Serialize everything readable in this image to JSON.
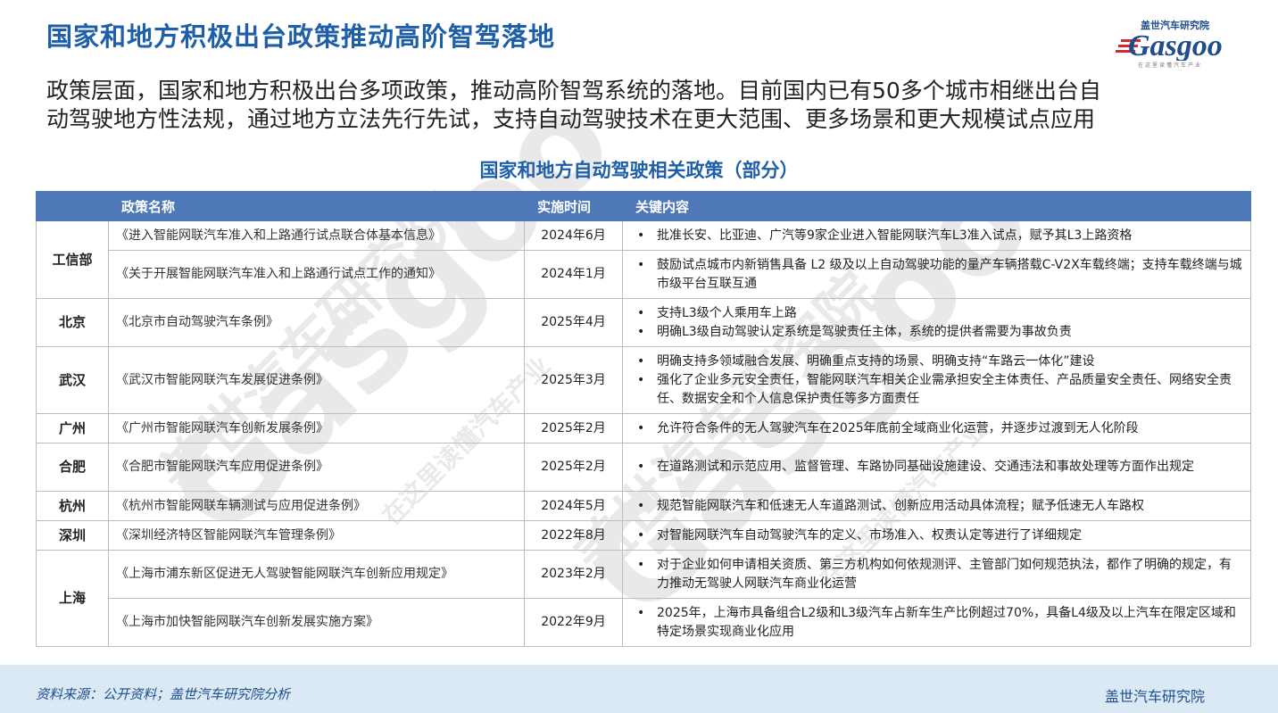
{
  "title": "国家和地方积极出台政策推动高阶智驾落地",
  "logo": {
    "top_text": "盖世汽车研究院",
    "word": "Gasgoo",
    "sub_text": "在这里读懂汽车产业"
  },
  "intro_lines": [
    "政策层面，国家和地方积极出台多项政策，推动高阶智驾系统的落地。目前国内已有50多个城市相继出台自",
    "动驾驶地方性法规，通过地方立法先行先试，支持自动驾驶技术在更大范围、更多场景和更大规模试点应用"
  ],
  "table_caption": "国家和地方自动驾驶相关政策（部分）",
  "table": {
    "headers": [
      "",
      "政策名称",
      "实施时间",
      "关键内容"
    ],
    "groups": [
      {
        "region": "工信部",
        "rows": [
          {
            "name": "《进入智能网联汽车准入和上路通行试点联合体基本信息》",
            "date": "2024年6月",
            "points": [
              "批准长安、比亚迪、广汽等9家企业进入智能网联汽车L3准入试点，赋予其L3上路资格"
            ]
          },
          {
            "name": "《关于开展智能网联汽车准入和上路通行试点工作的通知》",
            "date": "2024年1月",
            "points": [
              "鼓励试点城市内新销售具备 L2 级及以上自动驾驶功能的量产车辆搭载C-V2X车载终端；支持车载终端与城市级平台互联互通"
            ]
          }
        ]
      },
      {
        "region": "北京",
        "rows": [
          {
            "name": "《北京市自动驾驶汽车条例》",
            "date": "2025年4月",
            "points": [
              "支持L3级个人乘用车上路",
              "明确L3级自动驾驶认定系统是驾驶责任主体，系统的提供者需要为事故负责"
            ]
          }
        ]
      },
      {
        "region": "武汉",
        "rows": [
          {
            "name": "《武汉市智能网联汽车发展促进条例》",
            "date": "2025年3月",
            "points": [
              "明确支持多领域融合发展、明确重点支持的场景、明确支持“车路云一体化”建设",
              "强化了企业多元安全责任，智能网联汽车相关企业需承担安全主体责任、产品质量安全责任、网络安全责任、数据安全和个人信息保护责任等多方面责任"
            ]
          }
        ]
      },
      {
        "region": "广州",
        "rows": [
          {
            "name": "《广州市智能网联汽车创新发展条例》",
            "date": "2025年2月",
            "points": [
              "允许符合条件的无人驾驶汽车在2025年底前全域商业化运营，并逐步过渡到无人化阶段"
            ]
          }
        ]
      },
      {
        "region": "合肥",
        "rows": [
          {
            "name": "《合肥市智能网联汽车应用促进条例》",
            "date": "2025年2月",
            "points": [
              "在道路测试和示范应用、监督管理、车路协同基础设施建设、交通违法和事故处理等方面作出规定"
            ]
          }
        ]
      },
      {
        "region": "杭州",
        "rows": [
          {
            "name": "《杭州市智能网联车辆测试与应用促进条例》",
            "date": "2024年5月",
            "points": [
              "规范智能网联汽车和低速无人车道路测试、创新应用活动具体流程；赋予低速无人车路权"
            ]
          }
        ]
      },
      {
        "region": "深圳",
        "rows": [
          {
            "name": "《深圳经济特区智能网联汽车管理条例》",
            "date": "2022年8月",
            "points": [
              "对智能网联汽车自动驾驶汽车的定义、市场准入、权责认定等进行了详细规定"
            ]
          }
        ]
      },
      {
        "region": "上海",
        "rows": [
          {
            "name": "《上海市浦东新区促进无人驾驶智能网联汽车创新应用规定》",
            "date": "2023年2月",
            "points": [
              "对于企业如何申请相关资质、第三方机构如何依规测评、主管部门如何规范执法，都作了明确的规定，有力推动无驾驶人网联汽车商业化运营"
            ]
          },
          {
            "name": "《上海市加快智能网联汽车创新发展实施方案》",
            "date": "2022年9月",
            "points": [
              "2025年，上海市具备组合L2级和L3级汽车占新车生产比例超过70%，具备L4级及以上汽车在限定区域和特定场景实现商业化应用"
            ]
          }
        ]
      }
    ]
  },
  "footer": {
    "source": "资料来源：公开资料；盖世汽车研究院分析",
    "brand": "盖世汽车研究院"
  },
  "watermark": {
    "brand_cn": "盖世汽车研究院",
    "word": "Gasgoo",
    "slogan": "在这里读懂汽车产业"
  },
  "colors": {
    "title": "#1f5fa8",
    "header_bg": "#4e78b8",
    "footer_bg": "#dbe9f4",
    "logo_red": "#d7282f"
  }
}
